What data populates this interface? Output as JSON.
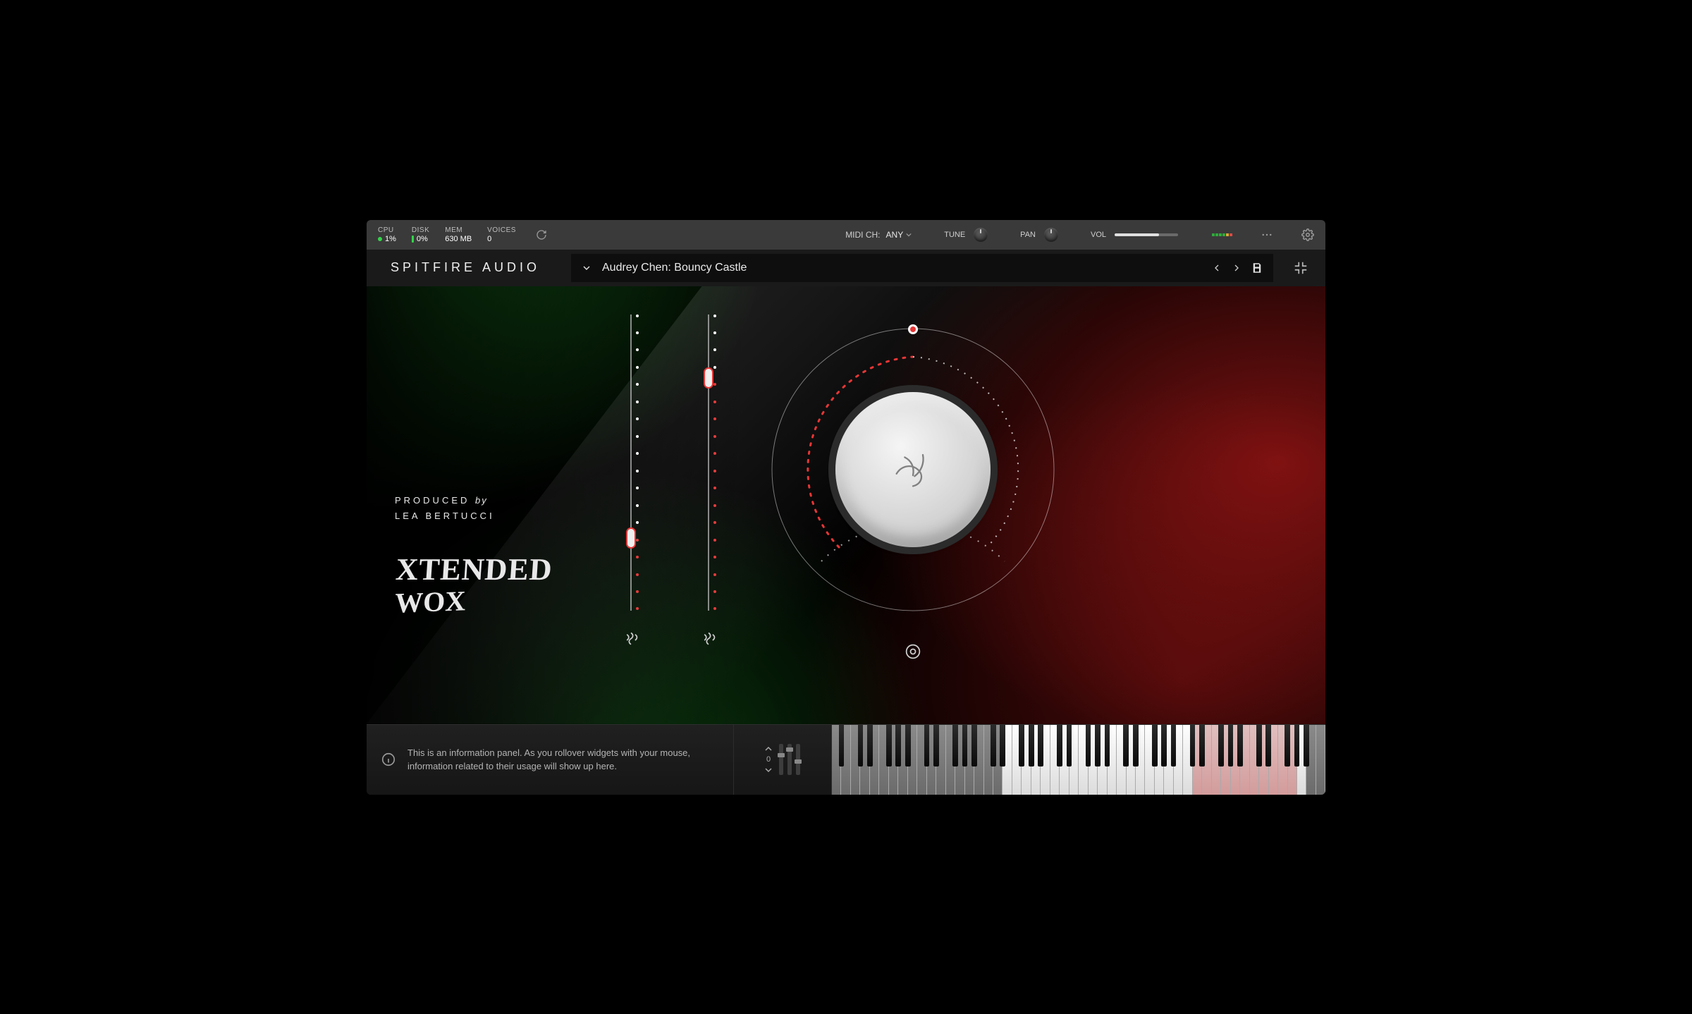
{
  "topbar": {
    "cpu": {
      "label": "CPU",
      "value": "1%"
    },
    "disk": {
      "label": "DISK",
      "value": "0%"
    },
    "mem": {
      "label": "MEM",
      "value": "630 MB"
    },
    "voices": {
      "label": "VOICES",
      "value": "0"
    },
    "midi_label": "MIDI CH:",
    "midi_value": "ANY",
    "tune_label": "TUNE",
    "pan_label": "PAN",
    "vol_label": "VOL"
  },
  "brand": "SPITFIRE AUDIO",
  "preset": {
    "name": "Audrey Chen: Bouncy Castle"
  },
  "left": {
    "produced_a": "PRODUCED",
    "produced_by": "by",
    "producer": "LEA BERTUCCI",
    "product_line1": "XTENDED",
    "product_line2": "WOX"
  },
  "footer_controls": {
    "octave_value": "0"
  },
  "info": {
    "text": "This is an information panel. As you rollover widgets with your mouse, information related to their usage will show up here."
  },
  "colors": {
    "accent_red": "#e63636",
    "accent_green": "#35d44b"
  }
}
